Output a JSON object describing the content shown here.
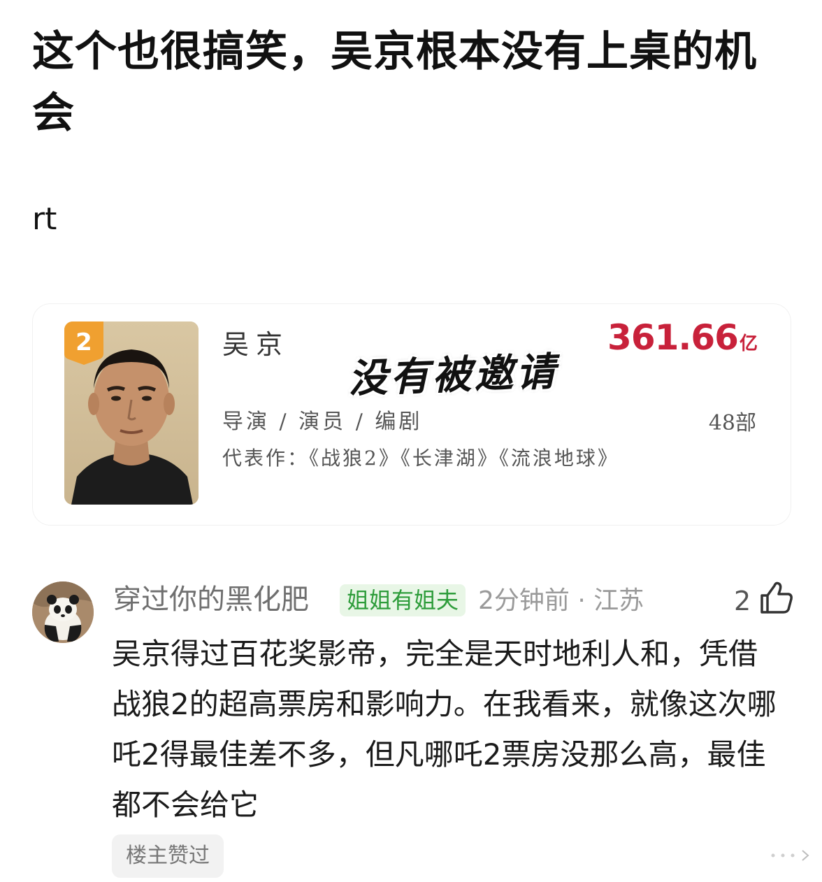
{
  "post": {
    "title": "这个也很搞笑，吴京根本没有上桌的机会",
    "body": "rt"
  },
  "card": {
    "rank": "2",
    "name": "吴京",
    "stamp": "没有被邀请",
    "box_office_value": "361.66",
    "box_office_unit": "亿",
    "roles": "导演 / 演员 / 编剧",
    "works_count": "48部",
    "representative": "代表作：《战狼2》《长津湖》《流浪地球》"
  },
  "comment": {
    "username": "穿过你的黑化肥",
    "badge": "姐姐有姐夫",
    "meta": "2分钟前 · 江苏",
    "like_count": "2",
    "text": "吴京得过百花奖影帝，完全是天时地利人和，凭借战狼2的超高票房和影响力。在我看来，就像这次哪吒2得最佳差不多，但凡哪吒2票房没那么高，最佳都不会给它",
    "liked_by_op": "楼主赞过"
  },
  "colors": {
    "box_office": "#c8213a",
    "badge_bg": "#e8f6e6",
    "badge_text": "#2d9c3a",
    "rank_badge": "#f0a030"
  },
  "icons": {
    "like": "thumbs-up-icon",
    "rank": "rank-badge-icon",
    "expand": "ellipsis-icon"
  }
}
